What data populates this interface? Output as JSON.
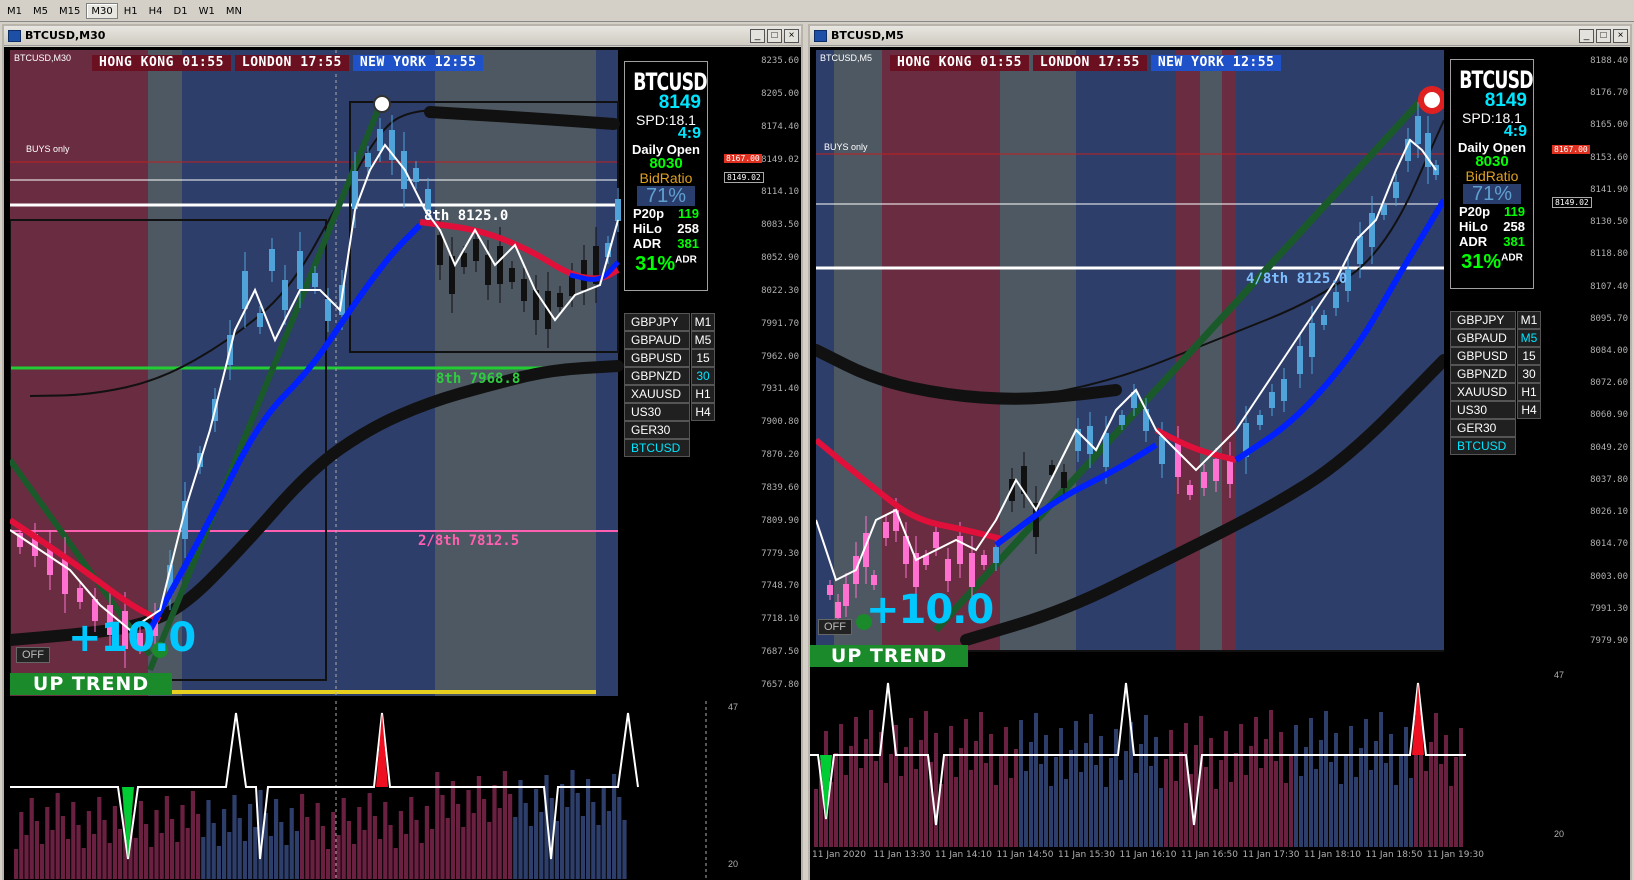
{
  "timeframes": [
    "M1",
    "M5",
    "M15",
    "M30",
    "H1",
    "H4",
    "D1",
    "W1",
    "MN"
  ],
  "active_timeframe": "M30",
  "left_window": {
    "title": "BTCUSD,M30",
    "chart_label": "BTCUSD,M30",
    "sessions": [
      {
        "label": "HONG KONG 01:55",
        "color": "#6a1020"
      },
      {
        "label": "LONDON  17:55",
        "color": "#6a1020"
      },
      {
        "label": "NEW YORK  12:55",
        "color": "#1f52c8"
      }
    ],
    "buys_only": "BUYS only",
    "price_scale": [
      "8235.60",
      "8205.00",
      "8174.40",
      "8149.02",
      "8114.10",
      "8083.50",
      "8052.90",
      "8022.30",
      "7991.70",
      "7962.00",
      "7931.40",
      "7900.80",
      "7870.20",
      "7839.60",
      "7809.90",
      "7779.30",
      "7748.70",
      "7718.10",
      "7687.50",
      "7657.80"
    ],
    "price_tag_red": "8167.00",
    "price_tag_cur": "8149.02",
    "level_6_8": "8th  8125.0",
    "level_4_8": "8th  7968.8",
    "level_2_8": "2/8th  7812.5",
    "plus_label": "+10.0",
    "off_label": "OFF",
    "trend_label": "UP TREND",
    "sub_scale_top": "47",
    "sub_scale_bottom": "20"
  },
  "right_window": {
    "title": "BTCUSD,M5",
    "chart_label": "BTCUSD,M5",
    "sessions": [
      {
        "label": "HONG KONG 01:55",
        "color": "#6a1020"
      },
      {
        "label": "LONDON  17:55",
        "color": "#6a1020"
      },
      {
        "label": "NEW YORK  12:55",
        "color": "#1f52c8"
      }
    ],
    "buys_only": "BUYS only",
    "price_scale": [
      "8188.40",
      "8176.70",
      "8165.00",
      "8153.60",
      "8141.90",
      "8130.50",
      "8118.80",
      "8107.40",
      "8095.70",
      "8084.00",
      "8072.60",
      "8060.90",
      "8049.20",
      "8037.80",
      "8026.10",
      "8014.70",
      "8003.00",
      "7991.30",
      "7979.90"
    ],
    "price_tag_red": "8167.00",
    "price_tag_cur": "8149.02",
    "level_4_8": "4/8th  8125.0",
    "plus_label": "+10.0",
    "off_label": "OFF",
    "trend_label": "UP TREND",
    "sub_scale_top": "47",
    "sub_scale_bottom": "20",
    "time_axis": [
      "11 Jan 2020",
      "11 Jan 13:30",
      "11 Jan 14:10",
      "11 Jan 14:50",
      "11 Jan 15:30",
      "11 Jan 16:10",
      "11 Jan 16:50",
      "11 Jan 17:30",
      "11 Jan 18:10",
      "11 Jan 18:50",
      "11 Jan 19:30"
    ]
  },
  "info": {
    "symbol": "BTCUSD",
    "price": "8149",
    "spread": "SPD:18.1",
    "ratio": "4:9",
    "daily_open_label": "Daily Open",
    "daily_open": "8030",
    "bid_ratio_label": "BidRatio",
    "bid_ratio": "71%",
    "p20_label": "P20p",
    "p20": "119",
    "hilo_label": "HiLo",
    "hilo": "258",
    "adr_label": "ADR",
    "adr": "381",
    "adr_pct": "31%",
    "adr_sup": "ADR"
  },
  "symbols_left": [
    {
      "name": "GBPJPY",
      "tf": "M1"
    },
    {
      "name": "GBPAUD",
      "tf": "M5"
    },
    {
      "name": "GBPUSD",
      "tf": "15"
    },
    {
      "name": "GBPNZD",
      "tf": "30"
    },
    {
      "name": "XAUUSD",
      "tf": "H1"
    },
    {
      "name": "US30",
      "tf": "H4"
    },
    {
      "name": "GER30",
      "tf": ""
    },
    {
      "name": "BTCUSD",
      "tf": ""
    }
  ],
  "symbols_right": [
    {
      "name": "GBPJPY",
      "tf": "M1"
    },
    {
      "name": "GBPAUD",
      "tf": "M5"
    },
    {
      "name": "GBPUSD",
      "tf": "15"
    },
    {
      "name": "GBPNZD",
      "tf": "30"
    },
    {
      "name": "XAUUSD",
      "tf": "H1"
    },
    {
      "name": "US30",
      "tf": "H4"
    },
    {
      "name": "GER30",
      "tf": ""
    },
    {
      "name": "BTCUSD",
      "tf": ""
    }
  ],
  "colors": {
    "bg_blue": "#2e3e6a",
    "bg_red": "#6a2c40",
    "bg_gray": "#4e5862",
    "candle": "#4fa3d9",
    "candle_pink": "#ff70d0",
    "ema_blue": "#0020ff",
    "ema_red": "#e0103a",
    "trend_green": "#1a8a2a",
    "cyan": "#00e5ff"
  }
}
